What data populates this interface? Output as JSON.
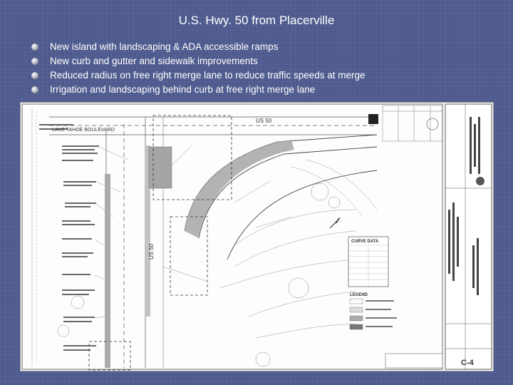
{
  "slide": {
    "title": "U.S. Hwy. 50 from Placerville",
    "bullets": [
      "New island with landscaping & ADA accessible ramps",
      "New curb and gutter and sidewalk improvements",
      "Reduced radius on free right merge lane  to reduce traffic speeds at merge",
      "Irrigation and landscaping behind curb at free right merge lane"
    ]
  },
  "plan": {
    "road_label_top": "US 50",
    "road_label_vertical": "US 50",
    "street_label": "LAKE TAHOE BOULEVARD",
    "curve_table_title": "CURVE DATA",
    "legend_title": "LEGEND",
    "sheet_number": "C-4",
    "colors": {
      "background": "#4f5b8e",
      "title_text": "#ffffff",
      "plan_paper": "#fdfdfd",
      "hatch_gray": "#a9a9a9"
    }
  }
}
